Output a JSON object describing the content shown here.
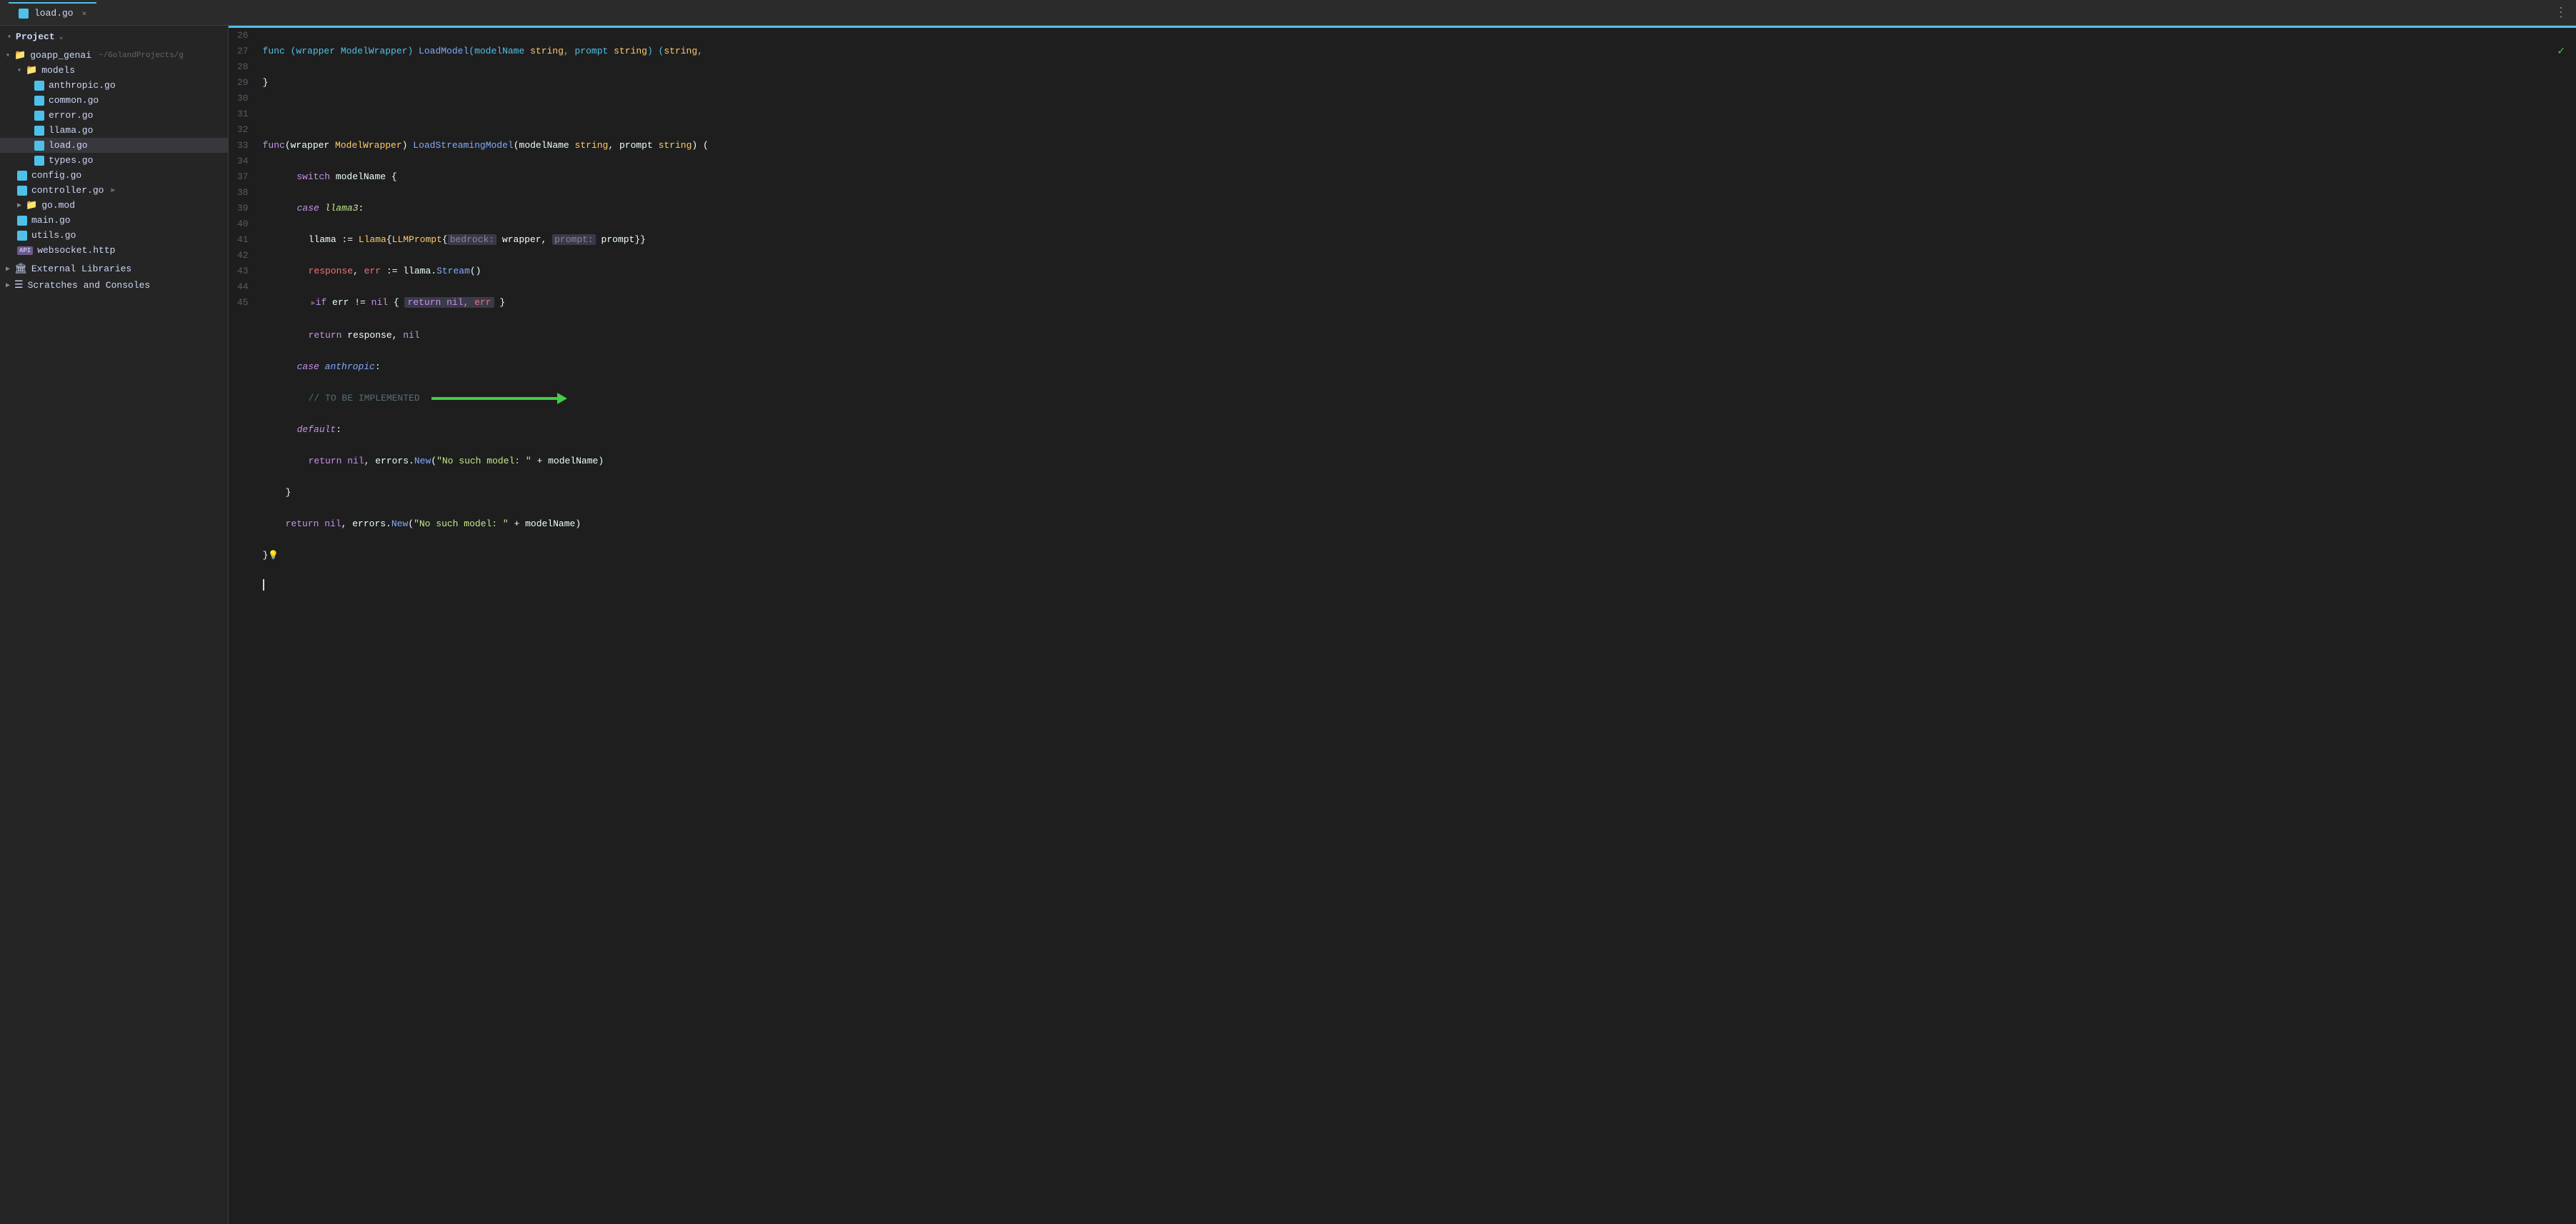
{
  "titleBar": {
    "tabIcon": "go-file",
    "tabName": "load.go",
    "threeDotsLabel": "⋮",
    "checkmark": "✓"
  },
  "sidebar": {
    "header": "Project",
    "chevron": "∨",
    "projectName": "goapp_genai",
    "projectPath": "~/GolandProjects/g",
    "items": [
      {
        "type": "folder",
        "label": "models",
        "depth": 1,
        "expanded": true
      },
      {
        "type": "file",
        "label": "anthropic.go",
        "depth": 2,
        "icon": "go"
      },
      {
        "type": "file",
        "label": "common.go",
        "depth": 2,
        "icon": "go"
      },
      {
        "type": "file",
        "label": "error.go",
        "depth": 2,
        "icon": "go"
      },
      {
        "type": "file",
        "label": "llama.go",
        "depth": 2,
        "icon": "go"
      },
      {
        "type": "file",
        "label": "load.go",
        "depth": 2,
        "icon": "go",
        "selected": true
      },
      {
        "type": "file",
        "label": "types.go",
        "depth": 2,
        "icon": "go"
      },
      {
        "type": "file",
        "label": "config.go",
        "depth": 1,
        "icon": "go"
      },
      {
        "type": "file",
        "label": "controller.go",
        "depth": 1,
        "icon": "go",
        "hasFold": true
      },
      {
        "type": "folder",
        "label": "go.mod",
        "depth": 1,
        "expanded": false,
        "icon": "folder"
      },
      {
        "type": "file",
        "label": "main.go",
        "depth": 1,
        "icon": "go"
      },
      {
        "type": "file",
        "label": "utils.go",
        "depth": 1,
        "icon": "go"
      },
      {
        "type": "file",
        "label": "websocket.http",
        "depth": 1,
        "icon": "api"
      }
    ],
    "externalLibraries": "External Libraries",
    "scratchesLabel": "Scratches and Consoles"
  },
  "editor": {
    "filename": "load.go",
    "lines": [
      {
        "num": "26",
        "content": "func_header_truncated"
      },
      {
        "num": "27",
        "content": "closing_brace"
      },
      {
        "num": "28",
        "content": "empty"
      },
      {
        "num": "29",
        "content": "load_streaming_sig"
      },
      {
        "num": "30",
        "content": "switch_model"
      },
      {
        "num": "31",
        "content": "case_llama3"
      },
      {
        "num": "32",
        "content": "llama_init"
      },
      {
        "num": "33",
        "content": "response_stream"
      },
      {
        "num": "34",
        "content": "if_err_fold"
      },
      {
        "num": "37",
        "content": "return_response"
      },
      {
        "num": "38",
        "content": "case_anthropic"
      },
      {
        "num": "39",
        "content": "todo_comment"
      },
      {
        "num": "40",
        "content": "case_default"
      },
      {
        "num": "41",
        "content": "return_error1"
      },
      {
        "num": "42",
        "content": "close_switch"
      },
      {
        "num": "43",
        "content": "return_error2"
      },
      {
        "num": "44",
        "content": "close_func"
      },
      {
        "num": "45",
        "content": "cursor"
      }
    ]
  }
}
